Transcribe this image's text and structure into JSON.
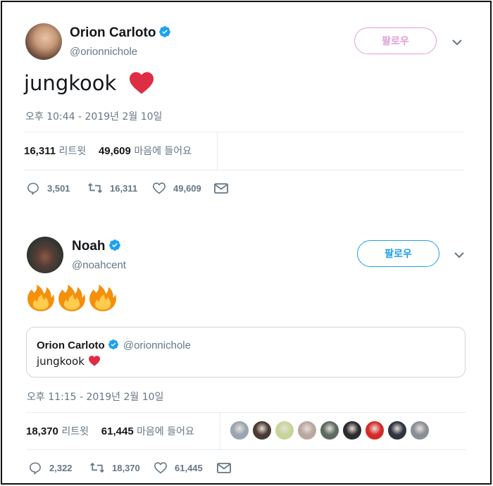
{
  "tweet1": {
    "author_name": "Orion Carloto",
    "author_handle": "@orionnichole",
    "follow_label": "팔로우",
    "text": "jungkook",
    "timestamp": "오후 10:44 - 2019년 2월 10일",
    "retweets_count": "16,311",
    "retweets_label": "리트윗",
    "likes_count": "49,609",
    "likes_label": "마음에 들어요",
    "reply_count": "3,501",
    "retweet_action_count": "16,311",
    "like_action_count": "49,609"
  },
  "tweet2": {
    "author_name": "Noah",
    "author_handle": "@noahcent",
    "follow_label": "팔로우",
    "quote": {
      "author_name": "Orion Carloto",
      "author_handle": "@orionnichole",
      "text": "jungkook"
    },
    "timestamp": "오후 11:15 - 2019년 2월 10일",
    "retweets_count": "18,370",
    "retweets_label": "리트윗",
    "likes_count": "61,445",
    "likes_label": "마음에 들어요",
    "reply_count": "2,322",
    "retweet_action_count": "18,370",
    "like_action_count": "61,445",
    "liker_colors": [
      "#9aa5b1",
      "#4a3a34",
      "#c7d49a",
      "#b9a8a0",
      "#5e6a60",
      "#2b2a2f",
      "#d62a2a",
      "#2e3340",
      "#8a8f95"
    ]
  },
  "colors": {
    "verified": "#1da1f2",
    "follow_pink": "#e0a0d8",
    "follow_blue": "#1da1f2",
    "heart": "#e0245e"
  }
}
